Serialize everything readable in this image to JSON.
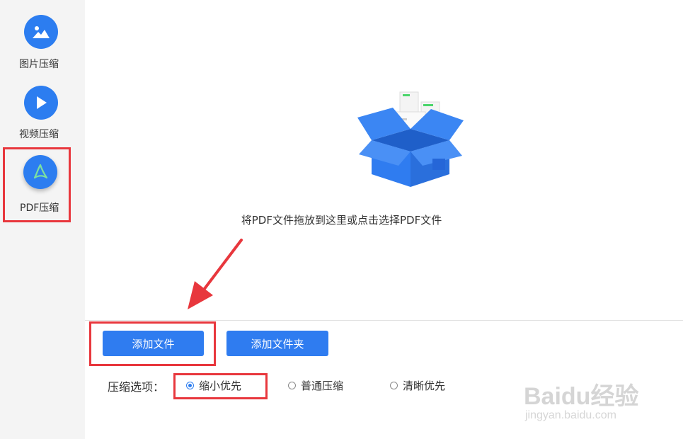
{
  "sidebar": {
    "items": [
      {
        "label": "图片压缩",
        "icon": "image-icon"
      },
      {
        "label": "视频压缩",
        "icon": "play-icon"
      },
      {
        "label": "PDF压缩",
        "icon": "pdf-icon",
        "active": true
      }
    ]
  },
  "drop_area": {
    "icon": "open-box-icon",
    "text": "将PDF文件拖放到这里或点击选择PDF文件"
  },
  "actions": {
    "add_file_label": "添加文件",
    "add_folder_label": "添加文件夹"
  },
  "compression": {
    "label": "压缩选项：",
    "options": [
      {
        "label": "缩小优先",
        "selected": true
      },
      {
        "label": "普通压缩",
        "selected": false
      },
      {
        "label": "清晰优先",
        "selected": false
      }
    ]
  },
  "watermark": {
    "brand": "Baidu经验",
    "url": "jingyan.baidu.com"
  },
  "colors": {
    "accent": "#2f7cf0",
    "highlight": "#e8373d",
    "sidebar_bg": "#f4f4f4"
  }
}
